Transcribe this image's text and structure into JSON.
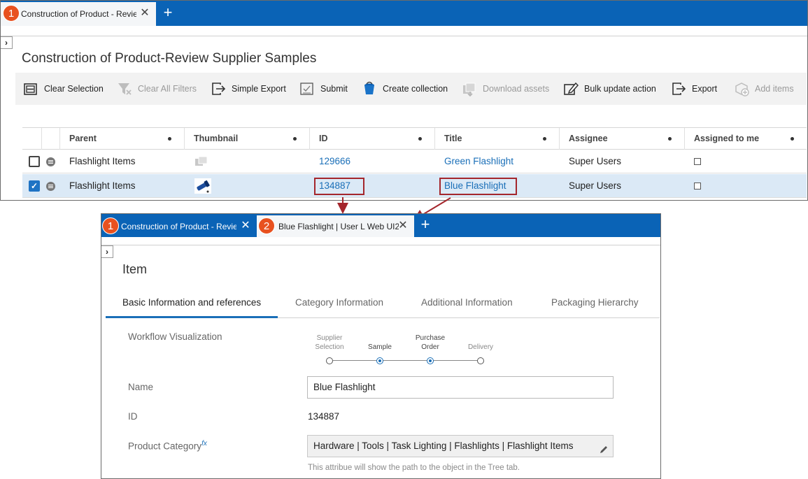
{
  "window1": {
    "badge": "1",
    "tab_title": "Construction of Product - Review Supplier Samples",
    "page_title": "Construction of Product-Review Supplier Samples",
    "toolbar": [
      {
        "label": "Clear Selection",
        "icon": "clear-selection-icon",
        "disabled": false
      },
      {
        "label": "Clear All Filters",
        "icon": "filter-clear-icon",
        "disabled": true
      },
      {
        "label": "Simple Export",
        "icon": "export-icon",
        "disabled": false
      },
      {
        "label": "Submit",
        "icon": "submit-icon",
        "disabled": false
      },
      {
        "label": "Create collection",
        "icon": "bucket-icon",
        "disabled": false
      },
      {
        "label": "Download assets",
        "icon": "download-assets-icon",
        "disabled": true
      },
      {
        "label": "Bulk update action",
        "icon": "bulk-edit-icon",
        "disabled": false
      },
      {
        "label": "Export",
        "icon": "export-icon",
        "disabled": false
      },
      {
        "label": "Add items",
        "icon": "add-items-icon",
        "disabled": true
      }
    ],
    "columns": [
      "Parent",
      "Thumbnail",
      "ID",
      "Title",
      "Assignee",
      "Assigned to me"
    ],
    "rows": [
      {
        "parent": "Flashlight Items",
        "id": "129666",
        "title": "Green Flashlight",
        "assignee": "Super Users",
        "checked": false
      },
      {
        "parent": "Flashlight Items",
        "id": "134887",
        "title": "Blue Flashlight",
        "assignee": "Super Users",
        "checked": true
      }
    ]
  },
  "window2": {
    "badge1": "1",
    "tab1_title": "Construction of Product - Review Supplier Samples",
    "badge2": "2",
    "tab2_title": "Blue Flashlight | User L Web UI2",
    "page_title": "Item",
    "tabs": [
      "Basic Information and references",
      "Category Information",
      "Additional Information",
      "Packaging Hierarchy"
    ],
    "workflow": {
      "label": "Workflow Visualization",
      "steps": [
        {
          "line1": "Supplier",
          "line2": "Selection",
          "active": false
        },
        {
          "line1": "",
          "line2": "Sample",
          "active": true
        },
        {
          "line1": "Purchase",
          "line2": "Order",
          "active": true
        },
        {
          "line1": "",
          "line2": "Delivery",
          "active": false
        }
      ]
    },
    "name_label": "Name",
    "name_value": "Blue Flashlight",
    "id_label": "ID",
    "id_value": "134887",
    "category_label": "Product Category",
    "category_fx": "fx",
    "category_value": "Hardware | Tools | Task Lighting | Flashlights | Flashlight Items",
    "category_hint": "This attribue will show the path to the object in the Tree tab."
  },
  "colors": {
    "tabbar": "#0a63b6",
    "badge": "#e8511f",
    "highlight": "#a4262c",
    "link": "#1a6fb8"
  }
}
